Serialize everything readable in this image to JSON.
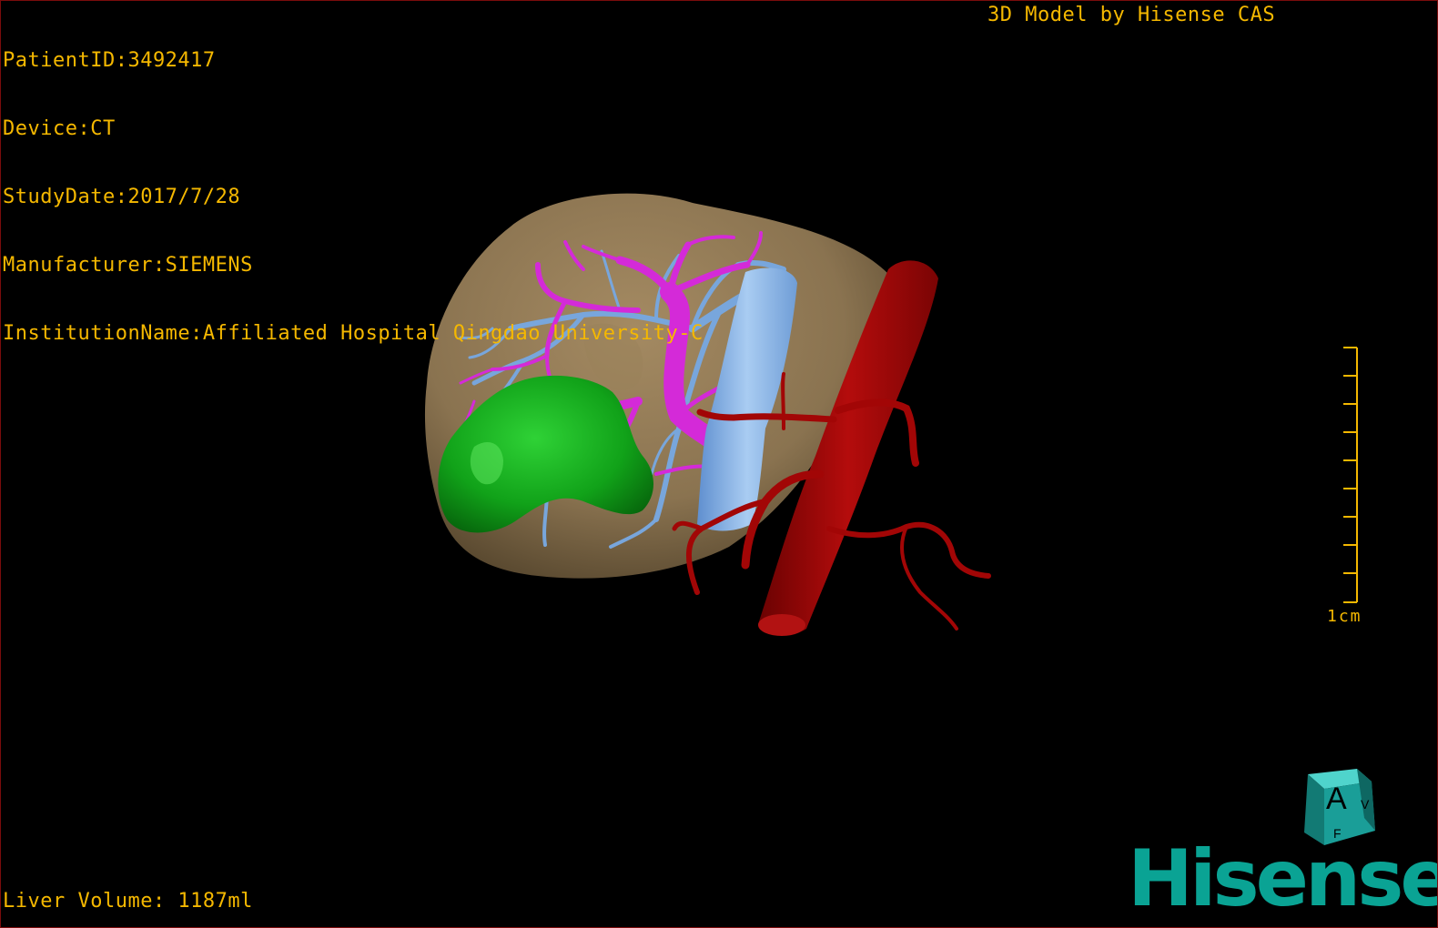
{
  "overlay": {
    "patient_id": "PatientID:3492417",
    "device": "Device:CT",
    "study_date": "StudyDate:2017/7/28",
    "manufacturer": "Manufacturer:SIEMENS",
    "institution": "InstitutionName:Affiliated Hospital Qingdao University-C",
    "credit": "3D Model by Hisense CAS",
    "liver_volume": "Liver Volume: 1187ml"
  },
  "scale_bar": {
    "label": "1cm"
  },
  "orientation_cube": {
    "front_letter": "A",
    "side_letter": "V",
    "bottom_letter": "F"
  },
  "logo": {
    "text": "Hisense"
  },
  "colors": {
    "overlay_text": "#f5b800",
    "liver": "#8a7350",
    "tumor": "#0f9c16",
    "portal_vein": "#d42ad8",
    "hepatic_vein": "#78a6dc",
    "ivc": "#8cb8ea",
    "artery": "#a20606",
    "logo": "#0aa394",
    "cube": "#1a9e98"
  }
}
